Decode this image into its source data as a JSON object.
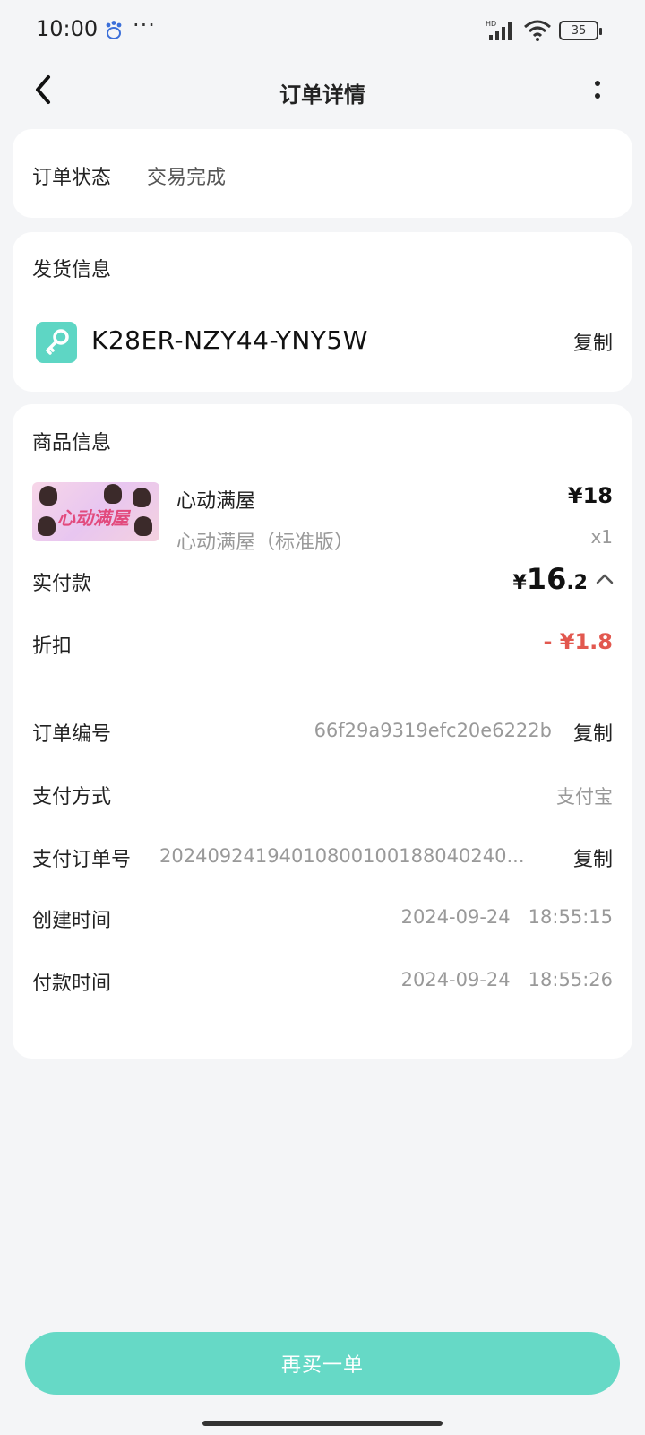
{
  "status_bar": {
    "time": "10:00",
    "dots": "···",
    "battery": "35",
    "network_label": "HD"
  },
  "nav": {
    "title": "订单详情"
  },
  "order_status": {
    "label": "订单状态",
    "value": "交易完成"
  },
  "delivery": {
    "title": "发货信息",
    "key_code": "K28ER-NZY44-YNY5W",
    "copy_label": "复制"
  },
  "product": {
    "section_title": "商品信息",
    "thumbnail_text": "心动满屋",
    "name": "心动满屋",
    "sku": "心动满屋（标准版）",
    "price": "¥18",
    "quantity": "x1"
  },
  "payment": {
    "paid_label": "实付款",
    "paid_currency": "¥",
    "paid_integer": "16",
    "paid_decimal": ".2",
    "discount_label": "折扣",
    "discount_value": "- ¥1.8"
  },
  "details": {
    "order_no_label": "订单编号",
    "order_no": "66f29a9319efc20e6222b",
    "order_no_copy": "复制",
    "pay_method_label": "支付方式",
    "pay_method": "支付宝",
    "pay_order_no_label": "支付订单号",
    "pay_order_no": "20240924194010800100188040240...",
    "pay_order_no_copy": "复制",
    "created_label": "创建时间",
    "created_time": "2024-09-24   18:55:15",
    "paid_time_label": "付款时间",
    "paid_time": "2024-09-24   18:55:26"
  },
  "footer": {
    "rebuy_label": "再买一单"
  },
  "colors": {
    "accent": "#66d9c6",
    "discount": "#e2584f",
    "background": "#f4f5f7"
  }
}
